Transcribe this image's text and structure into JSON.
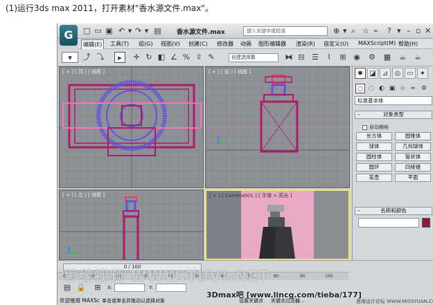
{
  "caption": "(1)运行3ds max 2011，打开素材\"香水源文件.max\"。",
  "app": {
    "logo": "G",
    "filename": "香水源文件.max",
    "search_placeholder": "键入关键字或短语",
    "menus": [
      "编辑(E)",
      "工具(T)",
      "组(G)",
      "视图(V)",
      "创建(C)",
      "修改器",
      "动画",
      "图形编辑器",
      "渲染(R)",
      "自定义(U)",
      "MAXScript(M)",
      "帮助(H)"
    ],
    "selection_set": "创建选择集",
    "toolbar_icons": [
      "select-icon",
      "move-icon",
      "rotate-icon",
      "scale-icon",
      "snap-icon",
      "angle-snap-icon",
      "percent-snap-icon",
      "mirror-icon",
      "align-icon",
      "layer-icon",
      "curve-editor-icon",
      "schematic-icon",
      "material-editor-icon",
      "render-setup-icon",
      "render-icon"
    ]
  },
  "viewports": {
    "top": "[ + ] [ 顶 ] [ 线框 ]",
    "front": "[ + ] [ 前 ] [ 线框 ]",
    "left": "[ + ] [ 左 ] [ 线框 ]",
    "camera": "[ + ] [ Camera001 ] [ 平滑 + 高光 ]"
  },
  "command_panel": {
    "category": "标准基本体",
    "object_type_title": "对象类型",
    "auto_grid": "自动栅格",
    "objects": [
      "长方体",
      "圆锥体",
      "球体",
      "几何球体",
      "圆柱体",
      "管状体",
      "圆环",
      "四棱锥",
      "茶壶",
      "平面"
    ],
    "name_color_title": "名称和颜色",
    "swatch_color": "#8b1c3a"
  },
  "timeline": {
    "slider": "0 / 100",
    "ticks": [
      "0",
      "10",
      "20",
      "30",
      "40",
      "50",
      "60",
      "70",
      "80",
      "90",
      "100"
    ]
  },
  "status": {
    "x_label": "X:",
    "y_label": "Y:",
    "welcome": "欢迎使用 MAXSc",
    "hint": "单击或单击并拖动以选择对象",
    "set_key": "设置关键点",
    "key_filter": "关键点过滤器..."
  },
  "watermark": {
    "main": "思缘视频  WWW.TUVI.NET",
    "site": "3Dmax吧 [www.lincg.com/tieba/177]",
    "site2": "思缘设计论坛 WWW.MISSYUAN.COM"
  },
  "colors": {
    "magenta": "#b0196a",
    "blue": "#5a56e0",
    "grid": "#8e9196",
    "camera_bg": "#e9a9c4",
    "active_border": "#f5e46a"
  }
}
